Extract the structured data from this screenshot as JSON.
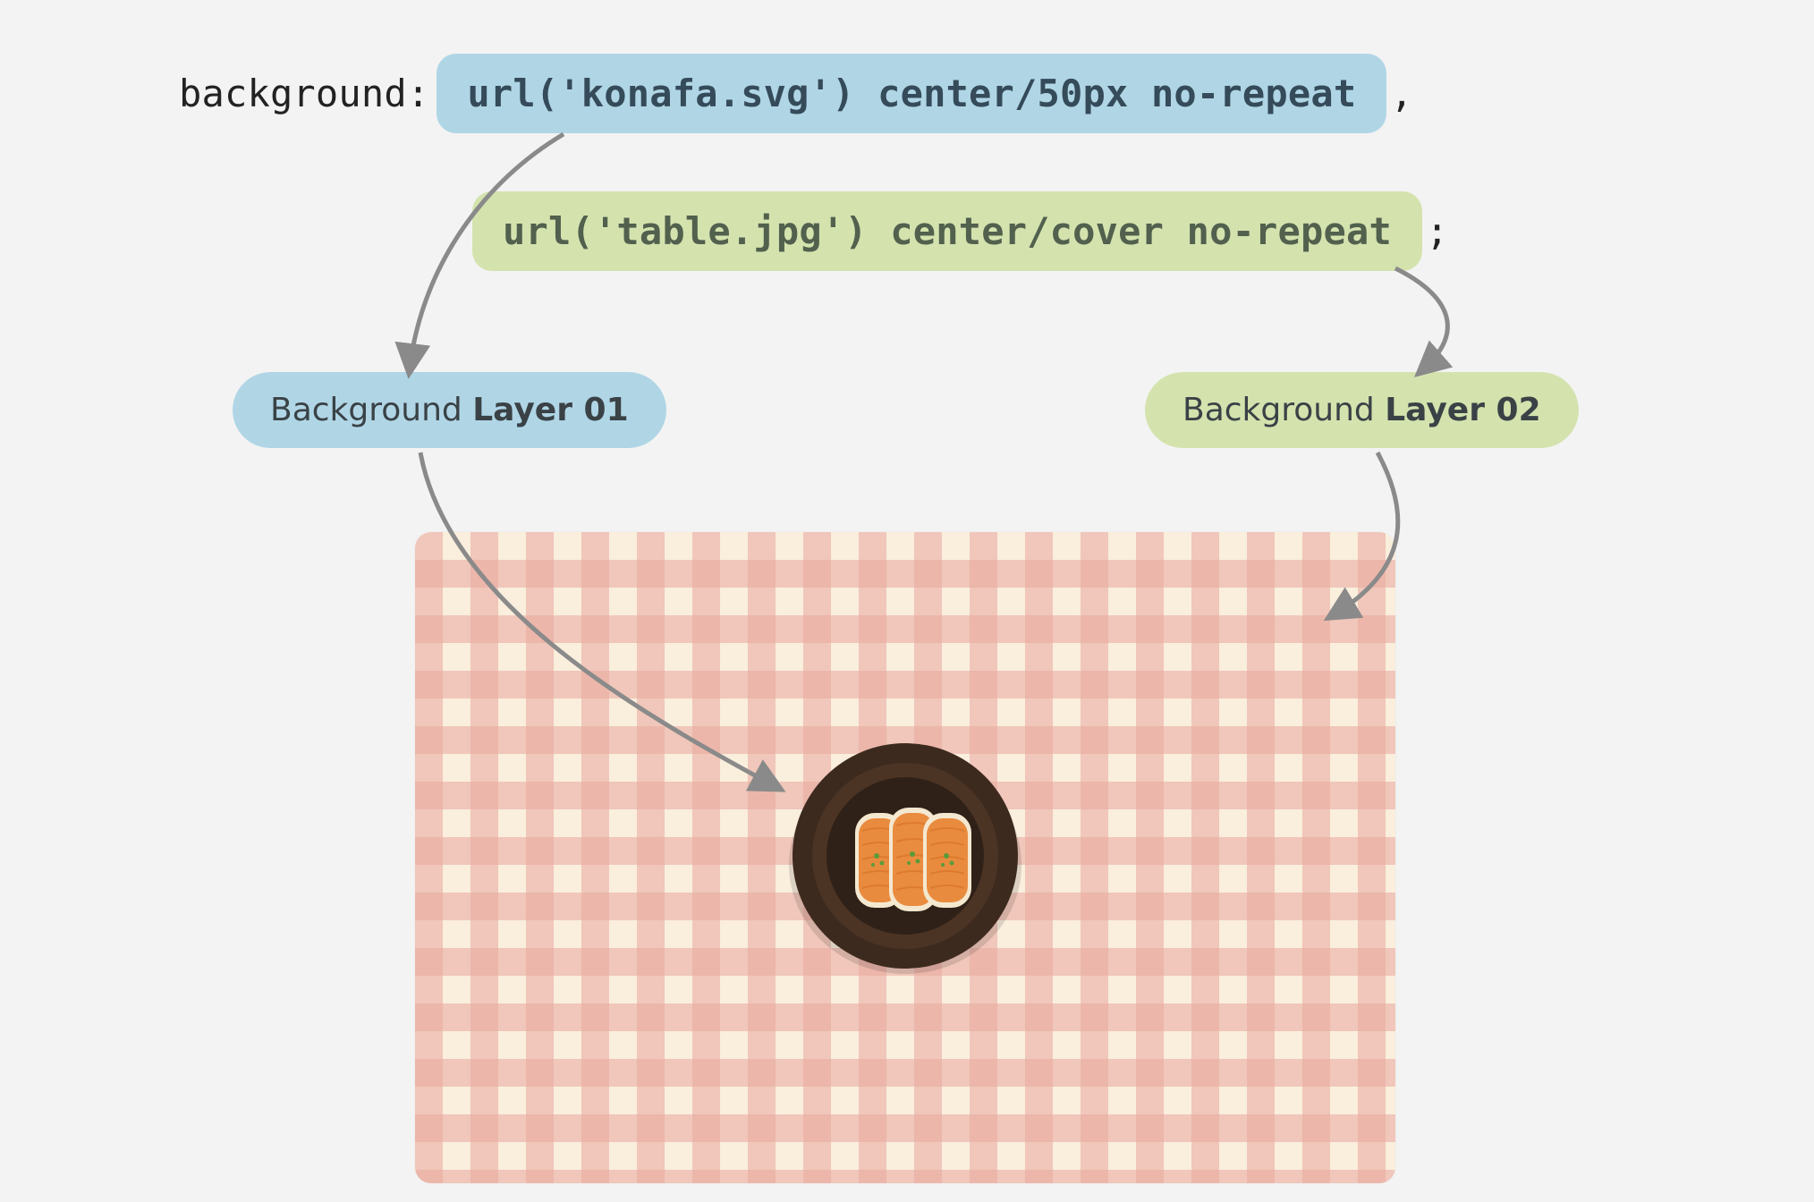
{
  "code": {
    "prefix": "background: ",
    "layer1_text": "url('konafa.svg') center/50px no-repeat",
    "comma": ",",
    "layer2_text": "url('table.jpg') center/cover no-repeat",
    "semicolon": ";"
  },
  "labels": {
    "layer1_prefix": "Background ",
    "layer1_bold": "Layer 01",
    "layer2_prefix": "Background ",
    "layer2_bold": "Layer 02"
  },
  "colors": {
    "pill_blue": "#b0d6e6",
    "pill_green": "#d4e3ae",
    "canvas_bg": "#f3f3f3",
    "arrow": "#8a8a8a",
    "text_dark": "#354b5a"
  },
  "preview": {
    "layer1_description": "konafa dessert on a dark plate",
    "layer2_description": "pink and cream gingham tablecloth"
  }
}
